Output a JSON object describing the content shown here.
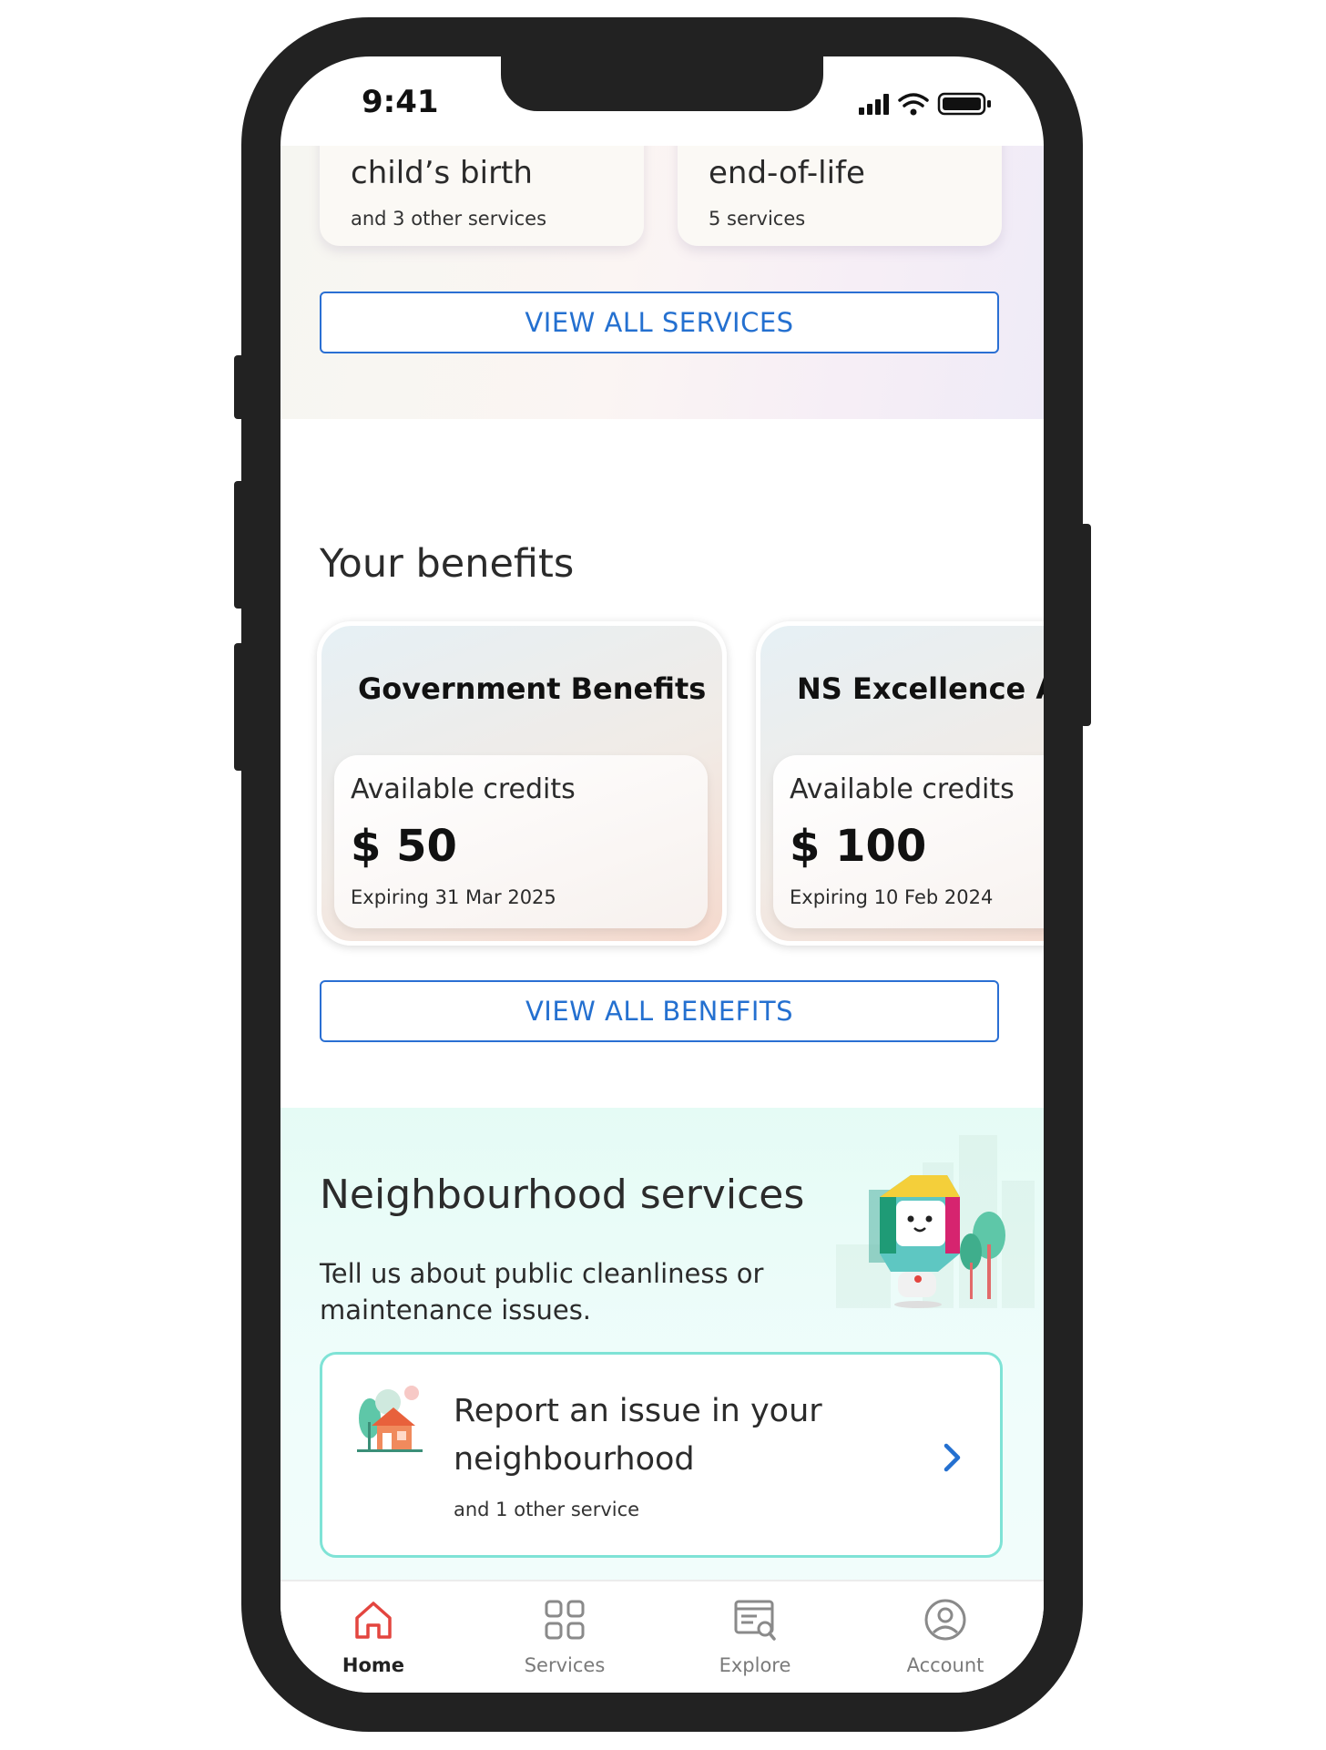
{
  "status_bar": {
    "time": "9:41"
  },
  "services_cards": [
    {
      "title": "child’s birth",
      "subtitle": "and 3 other services"
    },
    {
      "title": "end-of-life",
      "subtitle": "5 services"
    }
  ],
  "view_all_services_label": "VIEW ALL SERVICES",
  "benefits": {
    "title": "Your benefits",
    "cards": [
      {
        "title": "Government Benefits",
        "credits_label": "Available credits",
        "amount": "$ 50",
        "expiry": "Expiring 31 Mar 2025"
      },
      {
        "title": "NS Excellence Award",
        "credits_label": "Available credits",
        "amount": "$ 100",
        "expiry": "Expiring 10 Feb 2024"
      }
    ],
    "view_all_label": "VIEW ALL BENEFITS"
  },
  "neighbourhood": {
    "title": "Neighbourhood services",
    "description": "Tell us about public cleanliness or maintenance issues.",
    "report_card": {
      "title": "Report an issue in your neighbourhood",
      "subtitle": "and 1 other service"
    }
  },
  "tabs": [
    {
      "label": "Home",
      "icon": "home-icon",
      "active": true
    },
    {
      "label": "Services",
      "icon": "grid-icon",
      "active": false
    },
    {
      "label": "Explore",
      "icon": "explore-icon",
      "active": false
    },
    {
      "label": "Account",
      "icon": "account-icon",
      "active": false
    }
  ],
  "colors": {
    "accent": "#2470d0",
    "home_active": "#e3453f",
    "frame": "#222222",
    "teal_border": "#7fe3d6"
  }
}
